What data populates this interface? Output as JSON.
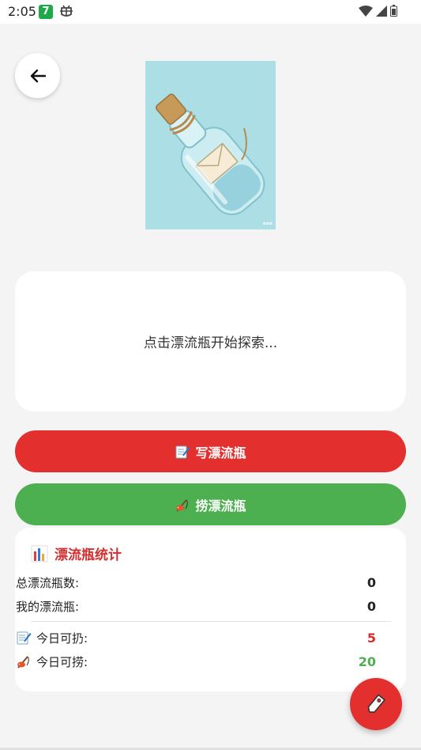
{
  "status_bar": {
    "time": "2:05",
    "badge": "7"
  },
  "explore": {
    "text": "点击漂流瓶开始探索..."
  },
  "buttons": {
    "write": "写漂流瓶",
    "fish": "捞漂流瓶"
  },
  "stats": {
    "title": "漂流瓶统计",
    "total_label": "总漂流瓶数:",
    "total_value": "0",
    "mine_label": "我的漂流瓶:",
    "mine_value": "0",
    "throw_label": "今日可扔:",
    "throw_value": "5",
    "fish_label": "今日可捞:",
    "fish_value": "20"
  },
  "colors": {
    "red": "#e3302f",
    "green": "#4caf50",
    "bg": "#f4f4f4"
  }
}
